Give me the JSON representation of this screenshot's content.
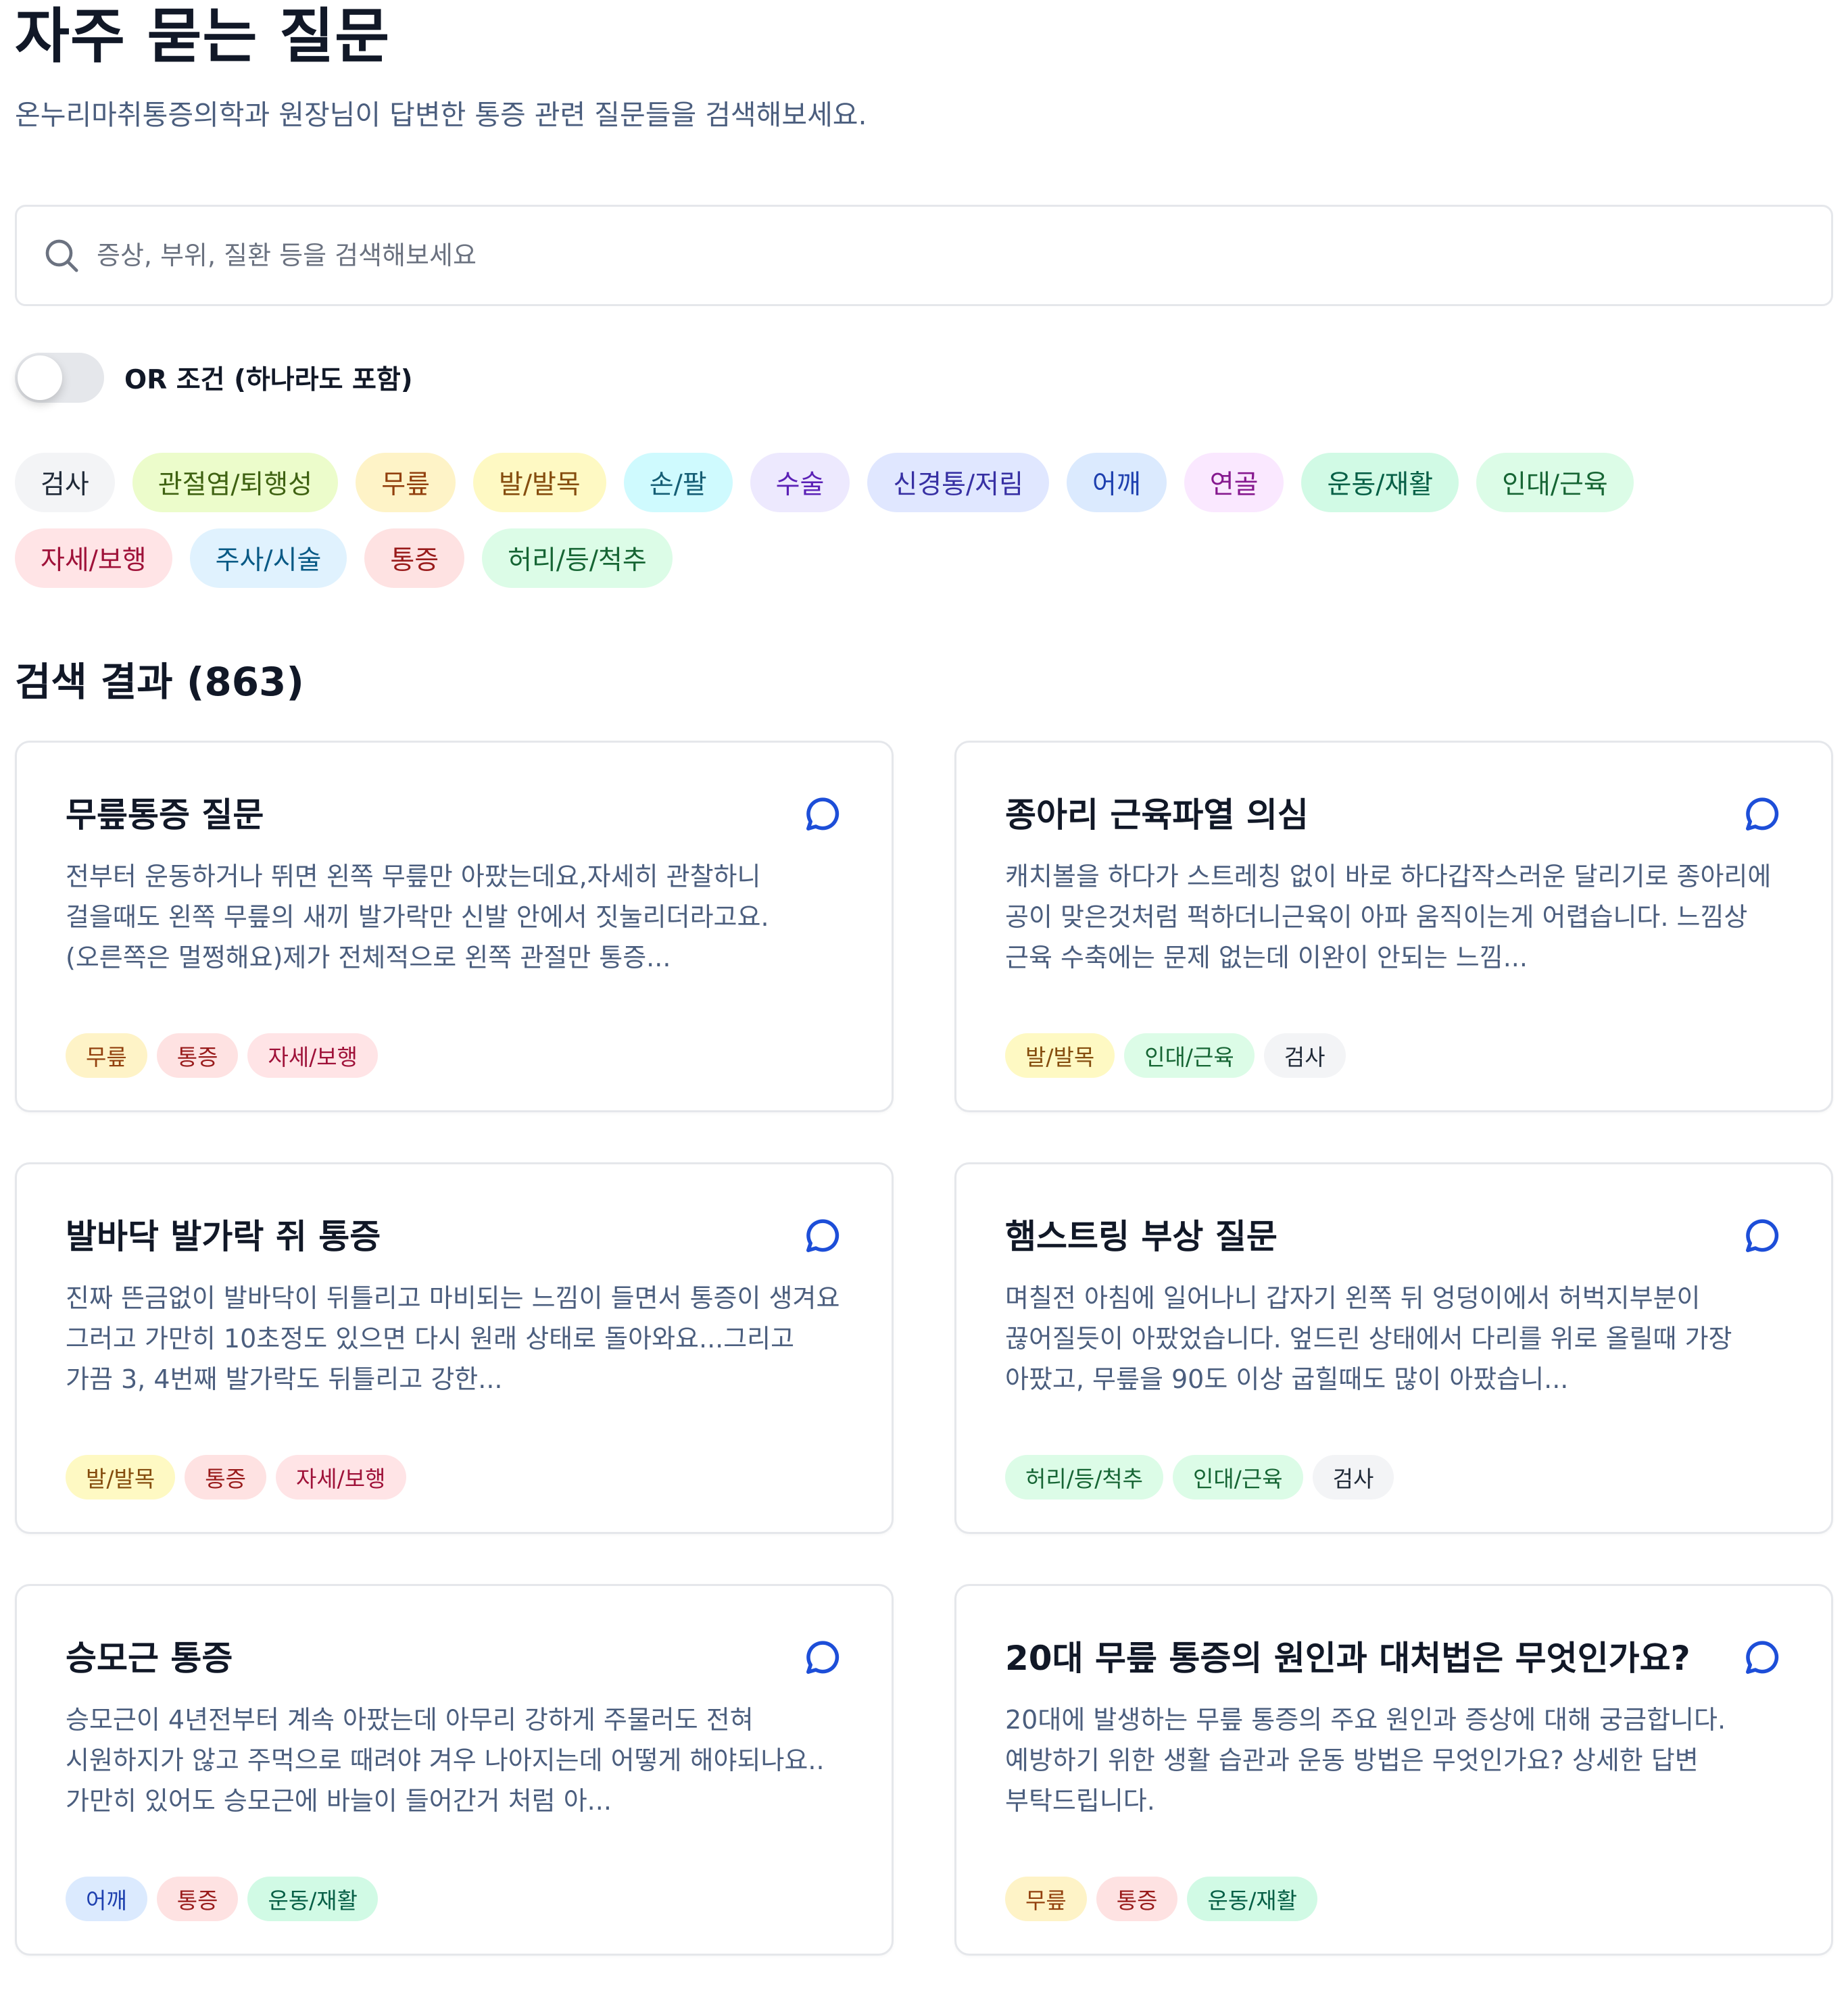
{
  "header": {
    "title": "자주 묻는 질문",
    "subtitle": "온누리마취통증의학과 원장님이 답변한 통증 관련 질문들을 검색해보세요."
  },
  "search": {
    "placeholder": "증상, 부위, 질환 등을 검색해보세요",
    "value": ""
  },
  "toggle": {
    "label": "OR 조건 (하나라도 포함)",
    "on": false
  },
  "category_colors": {
    "검사": {
      "bg": "#f3f4f6",
      "fg": "#1f2937"
    },
    "관절염/퇴행성": {
      "bg": "#ecfccb",
      "fg": "#3f6212"
    },
    "무릎": {
      "bg": "#fef3c7",
      "fg": "#92400e"
    },
    "발/발목": {
      "bg": "#fef9c3",
      "fg": "#854d0e"
    },
    "손/팔": {
      "bg": "#cffafe",
      "fg": "#155e75"
    },
    "수술": {
      "bg": "#ede9fe",
      "fg": "#5b21b6"
    },
    "신경통/저림": {
      "bg": "#e0e7ff",
      "fg": "#3730a3"
    },
    "어깨": {
      "bg": "#dbeafe",
      "fg": "#1e40af"
    },
    "연골": {
      "bg": "#fae8ff",
      "fg": "#86198f"
    },
    "운동/재활": {
      "bg": "#d1fae5",
      "fg": "#065f46"
    },
    "인대/근육": {
      "bg": "#dcfce7",
      "fg": "#166534"
    },
    "자세/보행": {
      "bg": "#ffe4e6",
      "fg": "#9f1239"
    },
    "주사/시술": {
      "bg": "#e0f2fe",
      "fg": "#075985"
    },
    "통증": {
      "bg": "#fee2e2",
      "fg": "#991b1b"
    },
    "허리/등/척추": {
      "bg": "#dcfce7",
      "fg": "#166534"
    }
  },
  "filters": [
    "검사",
    "관절염/퇴행성",
    "무릎",
    "발/발목",
    "손/팔",
    "수술",
    "신경통/저림",
    "어깨",
    "연골",
    "운동/재활",
    "인대/근육",
    "자세/보행",
    "주사/시술",
    "통증",
    "허리/등/척추"
  ],
  "results": {
    "heading": "검색 결과 (863)",
    "items": [
      {
        "title": "무릎통증 질문",
        "excerpt": "전부터 운동하거나 뛰면 왼쪽 무릎만 아팠는데요,자세히 관찰하니 걸을때도 왼쪽 무릎의 새끼 발가락만 신발 안에서 짓눌리더라고요. (오른쪽은 멀쩡해요)제가 전체적으로 왼쪽 관절만 통증...",
        "tags": [
          "무릎",
          "통증",
          "자세/보행"
        ]
      },
      {
        "title": "종아리 근육파열 의심",
        "excerpt": "캐치볼을 하다가 스트레칭 없이 바로 하다갑작스러운 달리기로 종아리에 공이 맞은것처럼 퍽하더니근육이 아파 움직이는게 어렵습니다. 느낌상 근육 수축에는 문제 없는데 이완이 안되는 느낌...",
        "tags": [
          "발/발목",
          "인대/근육",
          "검사"
        ]
      },
      {
        "title": "발바닥 발가락 쥐 통증",
        "excerpt": "진짜 뜬금없이 발바닥이 뒤틀리고 마비되는 느낌이 들면서 통증이 생겨요 그러고 가만히 10초정도 있으면 다시 원래 상태로 돌아와요...그리고 가끔 3, 4번째 발가락도 뒤틀리고 강한...",
        "tags": [
          "발/발목",
          "통증",
          "자세/보행"
        ]
      },
      {
        "title": "햄스트링 부상 질문",
        "excerpt": "며칠전 아침에 일어나니 갑자기 왼쪽 뒤 엉덩이에서 허벅지부분이 끊어질듯이 아팠었습니다. 엎드린 상태에서 다리를 위로 올릴때 가장 아팠고, 무릎을 90도 이상 굽힐때도 많이 아팠습니...",
        "tags": [
          "허리/등/척추",
          "인대/근육",
          "검사"
        ]
      },
      {
        "title": "승모근 통증",
        "excerpt": "승모근이 4년전부터 계속 아팠는데 아무리 강하게 주물러도 전혀 시원하지가 않고 주먹으로 때려야 겨우 나아지는데 어떻게 해야되나요.. 가만히 있어도 승모근에 바늘이 들어간거 처럼 아...",
        "tags": [
          "어깨",
          "통증",
          "운동/재활"
        ]
      },
      {
        "title": "20대 무릎 통증의 원인과 대처법은 무엇인가요?",
        "excerpt": "20대에 발생하는 무릎 통증의 주요 원인과 증상에 대해 궁금합니다. 예방하기 위한 생활 습관과 운동 방법은 무엇인가요? 상세한 답변 부탁드립니다.",
        "tags": [
          "무릎",
          "통증",
          "운동/재활"
        ]
      }
    ]
  }
}
